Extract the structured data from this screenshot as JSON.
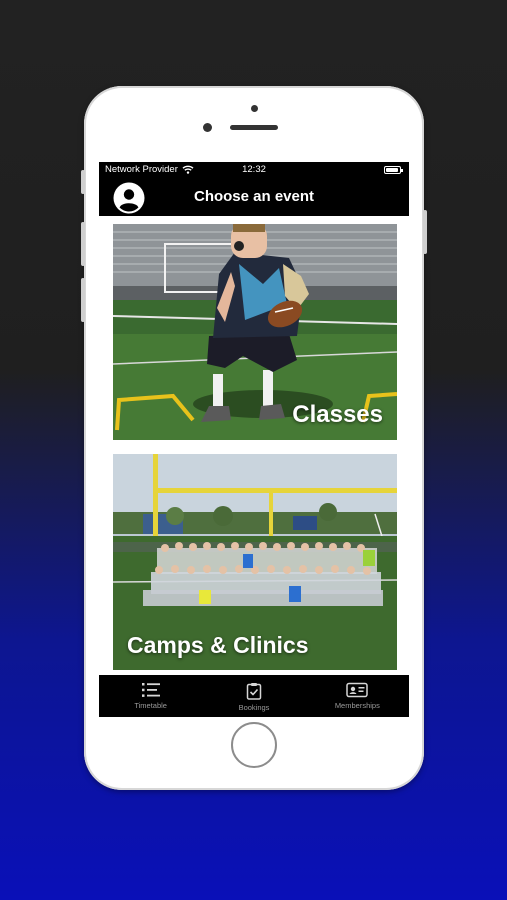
{
  "status_bar": {
    "carrier": "Network Provider",
    "time": "12:32",
    "battery_level": 0.9
  },
  "nav": {
    "title": "Choose an event",
    "avatar_icon": "user-circle-icon"
  },
  "events": [
    {
      "label": "Classes",
      "image": "youth-football-player-with-ball-photo"
    },
    {
      "label": "Camps & Clinics",
      "image": "youth-football-camp-group-photo"
    }
  ],
  "tabs": [
    {
      "label": "Timetable",
      "icon": "list-icon"
    },
    {
      "label": "Bookings",
      "icon": "clipboard-check-icon"
    },
    {
      "label": "Memberships",
      "icon": "membership-card-icon"
    }
  ],
  "colors": {
    "background_top": "#222222",
    "background_bottom": "#0a10b8",
    "bar": "#000000"
  }
}
